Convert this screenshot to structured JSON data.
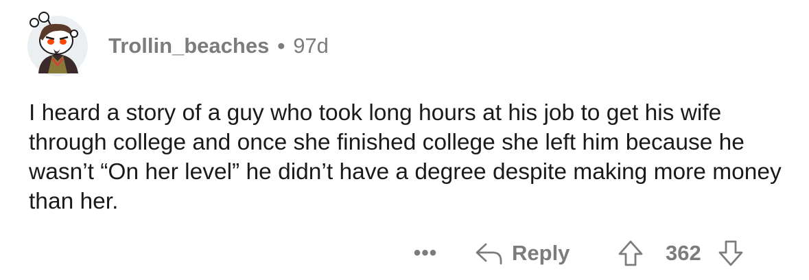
{
  "comment": {
    "username": "Trollin_beaches",
    "separator": "•",
    "age": "97d",
    "body": "I heard a story of a guy who took long hours at his job to get his wife through college and once she finished college she left him because he wasn’t “On her level” he didn’t have a degree despite making more money than her.",
    "avatar_icon": "snoo-avatar-icon"
  },
  "actions": {
    "more_label": "•••",
    "reply_label": "Reply",
    "vote_count": "362",
    "icons": {
      "reply": "reply-arrow-icon",
      "upvote": "upvote-arrow-icon",
      "downvote": "downvote-arrow-icon"
    }
  },
  "colors": {
    "text": "#1a1a1b",
    "meta": "#7c7c7c",
    "background": "#ffffff",
    "avatar_bg": "#eceff1"
  }
}
